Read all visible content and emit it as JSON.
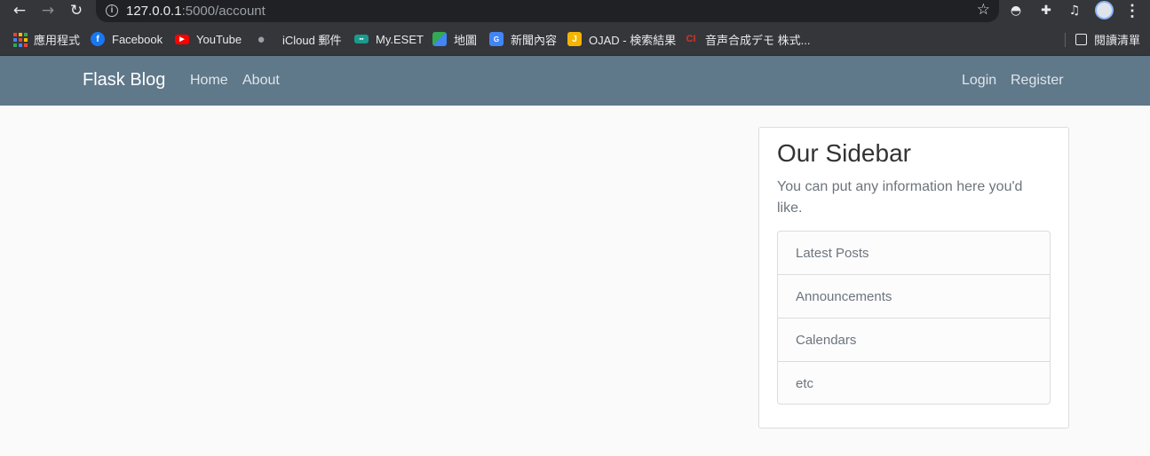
{
  "browser": {
    "url_host": "127.0.0.1",
    "url_path": ":5000/account",
    "reading_list_label": "閱讀清單"
  },
  "bookmarks": [
    {
      "label": "應用程式",
      "icon": "apps-grid-icon",
      "color": "#e8eaed"
    },
    {
      "label": "Facebook",
      "icon": "facebook-icon",
      "color": "#1877f2"
    },
    {
      "label": "YouTube",
      "icon": "youtube-icon",
      "color": "#ff0000"
    },
    {
      "label": "iCloud 郵件",
      "icon": "apple-icon",
      "color": "#9aa0a6"
    },
    {
      "label": "My.ESET",
      "icon": "eset-icon",
      "color": "#1a9b8f"
    },
    {
      "label": "地圖",
      "icon": "maps-icon",
      "color": "#34a853"
    },
    {
      "label": "新聞內容",
      "icon": "news-icon",
      "color": "#4285f4"
    },
    {
      "label": "OJAD - 検索結果",
      "icon": "ojad-icon",
      "color": "#f4b400"
    },
    {
      "label": "音声合成デモ 株式...",
      "icon": "cm-icon",
      "color": "#d93025"
    }
  ],
  "navbar": {
    "brand": "Flask Blog",
    "left_links": [
      "Home",
      "About"
    ],
    "right_links": [
      "Login",
      "Register"
    ],
    "background": "#5f788a"
  },
  "sidebar": {
    "title": "Our Sidebar",
    "description": "You can put any information here you'd like.",
    "items": [
      "Latest Posts",
      "Announcements",
      "Calendars",
      "etc"
    ]
  }
}
